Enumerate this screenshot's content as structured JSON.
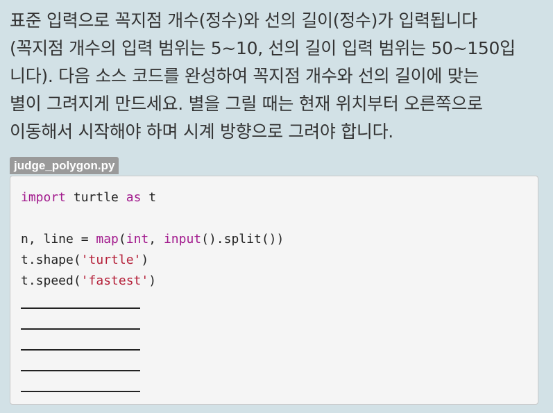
{
  "description": {
    "lines": [
      "표준 입력으로 꼭지점 개수(정수)와 선의 길이(정수)가 입력됩니다",
      "(꼭지점 개수의 입력 범위는 5~10, 선의 길이 입력 범위는 50~150입",
      "니다). 다음 소스 코드를 완성하여 꼭지점 개수와 선의 길이에 맞는",
      "별이 그려지게 만드세요. 별을 그릴 때는 현재 위치부터 오른쪽으로",
      "이동해서 시작해야 하며 시계 방향으로 그려야 합니다."
    ]
  },
  "code_file": {
    "filename": "judge_polygon.py",
    "line1": {
      "kw1": "import",
      "t1": " turtle ",
      "kw2": "as",
      "t2": " t"
    },
    "line3": {
      "t1": "n, line = ",
      "f1": "map",
      "t2": "(",
      "f2": "int",
      "t3": ", ",
      "f3": "input",
      "t4": "().split())"
    },
    "line4": {
      "t1": "t.shape(",
      "s1": "'turtle'",
      "t2": ")"
    },
    "line5": {
      "t1": "t.speed(",
      "s1": "'fastest'",
      "t2": ")"
    },
    "blank_count": 5
  }
}
